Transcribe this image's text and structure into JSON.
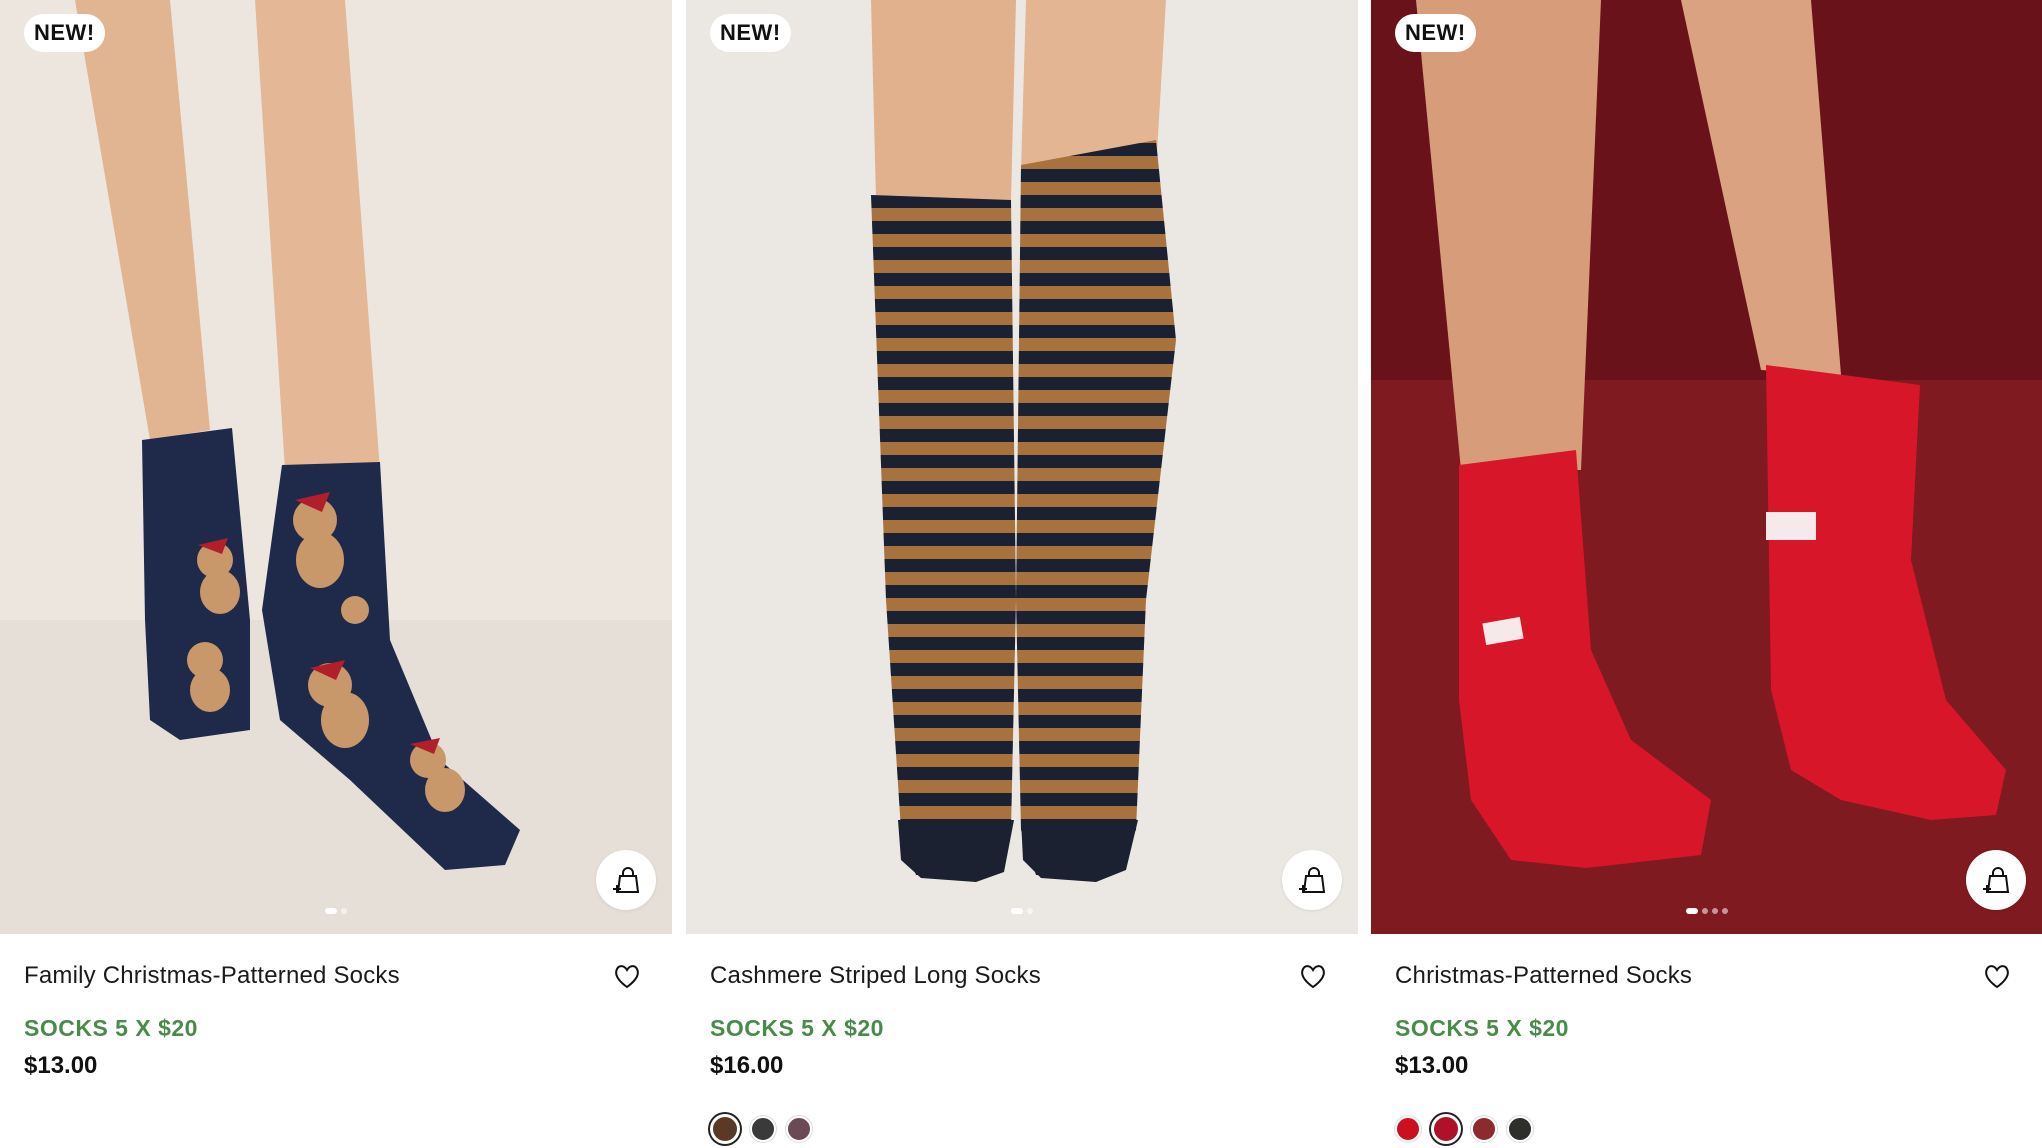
{
  "products": [
    {
      "badge": "NEW!",
      "title": "Family Christmas-Patterned Socks",
      "promo": "SOCKS 5 X $20",
      "price": "$13.00",
      "image_dots": 2,
      "swatches": []
    },
    {
      "badge": "NEW!",
      "title": "Cashmere Striped Long Socks",
      "promo": "SOCKS 5 X $20",
      "price": "$16.00",
      "image_dots": 2,
      "swatches": [
        "#5a3a24",
        "#3a3a3a",
        "#6b4a55"
      ]
    },
    {
      "badge": "NEW!",
      "title": "Christmas-Patterned Socks",
      "promo": "SOCKS 5 X $20",
      "price": "$13.00",
      "image_dots": 4,
      "swatches": [
        "#cc1020",
        "#b0102a",
        "#8c2a30",
        "#2e2e2a"
      ]
    }
  ],
  "icons": {
    "quick_add": "bag-plus-icon",
    "wishlist": "heart-icon"
  },
  "colors": {
    "promo_green": "#4a8a4a",
    "card1_bg": "#ece6df",
    "card2_bg": "#ebe8e4",
    "card3_bg": "#7e1a20"
  }
}
